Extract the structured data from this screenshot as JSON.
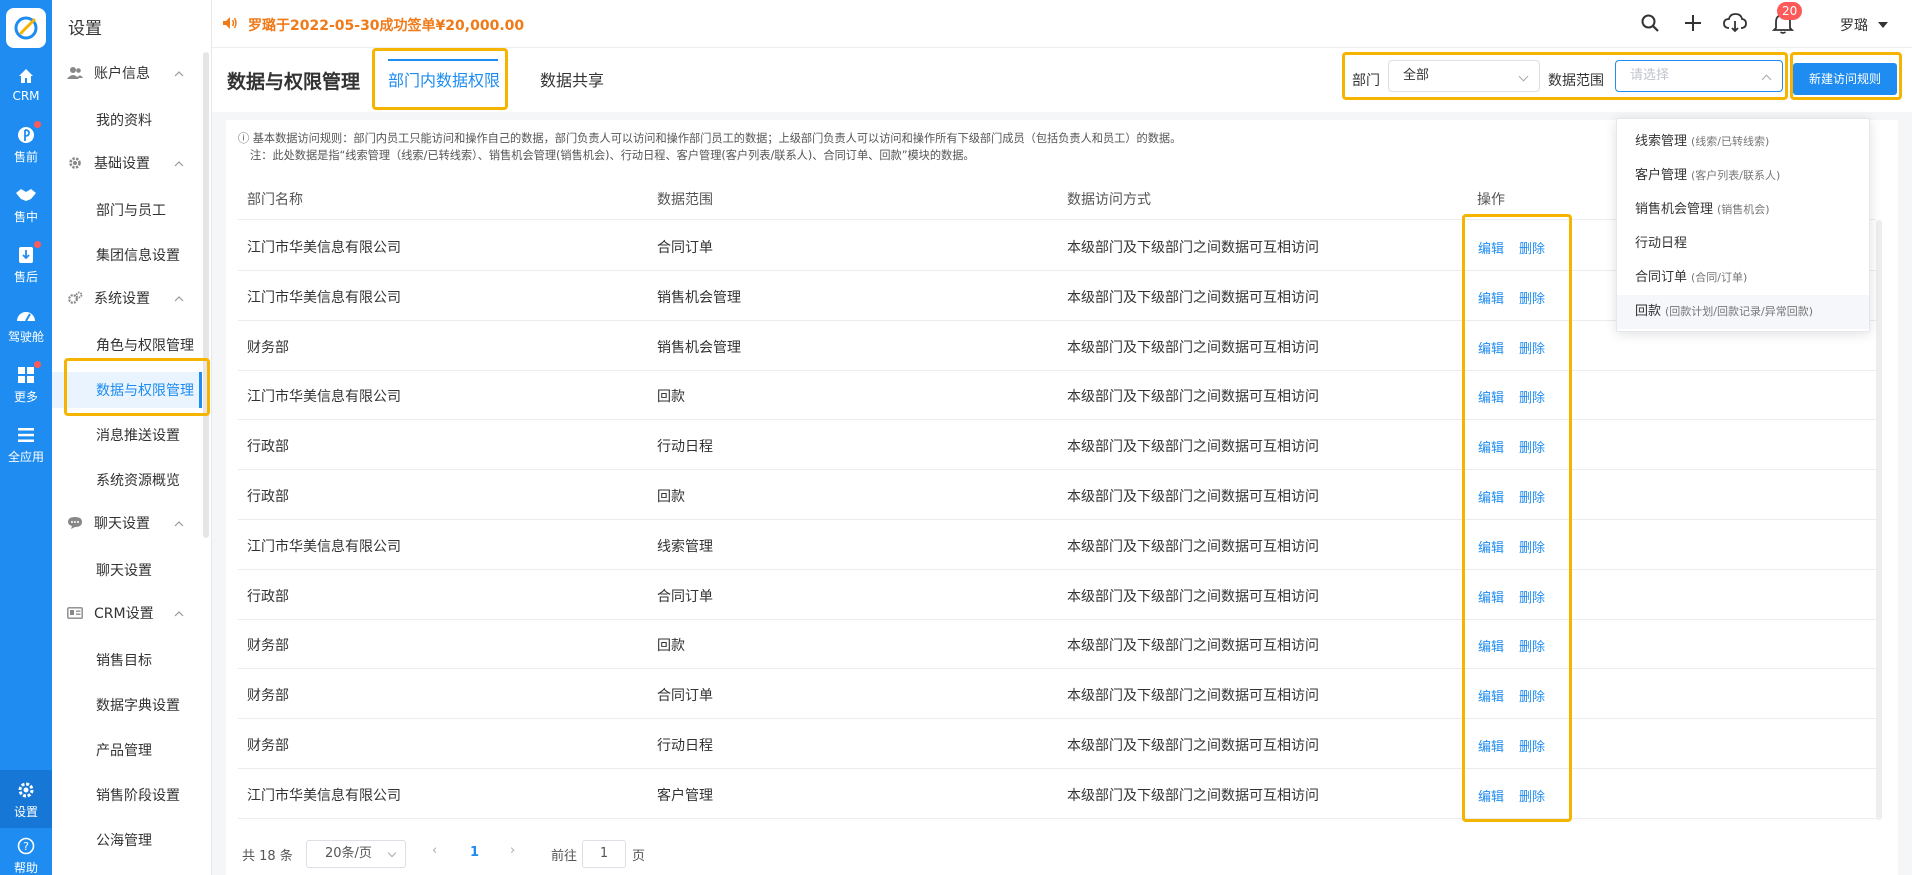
{
  "notice": "罗璐于2022-05-30成功签单¥20,000.00",
  "notification_count": "20",
  "user_name": "罗璐",
  "rail": [
    {
      "label": "CRM",
      "icon": "home-icon"
    },
    {
      "label": "售前",
      "icon": "pin-icon"
    },
    {
      "label": "售中",
      "icon": "handshake-icon"
    },
    {
      "label": "售后",
      "icon": "service-icon"
    },
    {
      "label": "驾驶舱",
      "icon": "dashboard-icon"
    },
    {
      "label": "更多",
      "icon": "grid-icon"
    },
    {
      "label": "全应用",
      "icon": "menu-icon"
    },
    {
      "label": "设置",
      "icon": "gear-icon"
    },
    {
      "label": "帮助",
      "icon": "help-icon"
    }
  ],
  "sidebar": {
    "title": "设置",
    "groups": [
      {
        "label": "账户信息",
        "items": [
          "我的资料"
        ]
      },
      {
        "label": "基础设置",
        "items": [
          "部门与员工",
          "集团信息设置"
        ]
      },
      {
        "label": "系统设置",
        "items": [
          "角色与权限管理",
          "数据与权限管理",
          "消息推送设置",
          "系统资源概览"
        ]
      },
      {
        "label": "聊天设置",
        "items": [
          "聊天设置"
        ]
      },
      {
        "label": "CRM设置",
        "items": [
          "销售目标",
          "数据字典设置",
          "产品管理",
          "销售阶段设置",
          "公海管理"
        ]
      }
    ]
  },
  "page": {
    "title": "数据与权限管理",
    "tabs": [
      "部门内数据权限",
      "数据共享"
    ],
    "filter_dept_label": "部门",
    "filter_dept_value": "全部",
    "filter_scope_label": "数据范围",
    "filter_scope_placeholder": "请选择",
    "new_rule_button": "新建访问规则"
  },
  "rules": {
    "line1": "ⓘ 基本数据访问规则：部门内员工只能访问和操作自己的数据，部门负责人可以访问和操作部门员工的数据；上级部门负责人可以访问和操作所有下级部门成员（包括负责人和员工）的数据。",
    "line2": "注：此处数据是指“线索管理（线索/已转线索）、销售机会管理(销售机会)、行动日程、客户管理(客户列表/联系人)、合同订单、回款”模块的数据。"
  },
  "table": {
    "headers": [
      "部门名称",
      "数据范围",
      "数据访问方式",
      "操作"
    ],
    "edit_label": "编辑",
    "delete_label": "删除",
    "rows": [
      [
        "江门市华美信息有限公司",
        "合同订单",
        "本级部门及下级部门之间数据可互相访问"
      ],
      [
        "江门市华美信息有限公司",
        "销售机会管理",
        "本级部门及下级部门之间数据可互相访问"
      ],
      [
        "财务部",
        "销售机会管理",
        "本级部门及下级部门之间数据可互相访问"
      ],
      [
        "江门市华美信息有限公司",
        "回款",
        "本级部门及下级部门之间数据可互相访问"
      ],
      [
        "行政部",
        "行动日程",
        "本级部门及下级部门之间数据可互相访问"
      ],
      [
        "行政部",
        "回款",
        "本级部门及下级部门之间数据可互相访问"
      ],
      [
        "江门市华美信息有限公司",
        "线索管理",
        "本级部门及下级部门之间数据可互相访问"
      ],
      [
        "行政部",
        "合同订单",
        "本级部门及下级部门之间数据可互相访问"
      ],
      [
        "财务部",
        "回款",
        "本级部门及下级部门之间数据可互相访问"
      ],
      [
        "财务部",
        "合同订单",
        "本级部门及下级部门之间数据可互相访问"
      ],
      [
        "财务部",
        "行动日程",
        "本级部门及下级部门之间数据可互相访问"
      ],
      [
        "江门市华美信息有限公司",
        "客户管理",
        "本级部门及下级部门之间数据可互相访问"
      ]
    ]
  },
  "dropdown": [
    {
      "label": "线索管理",
      "sub": "(线索/已转线索)"
    },
    {
      "label": "客户管理",
      "sub": "(客户列表/联系人)"
    },
    {
      "label": "销售机会管理",
      "sub": "(销售机会)"
    },
    {
      "label": "行动日程",
      "sub": ""
    },
    {
      "label": "合同订单",
      "sub": "(合同/订单)"
    },
    {
      "label": "回款",
      "sub": "(回款计划/回款记录/异常回款)"
    }
  ],
  "pagination": {
    "total": "共 18 条",
    "page_size": "20条/页",
    "current": "1",
    "goto_label": "前往",
    "goto_value": "1",
    "page_suffix": "页"
  },
  "colors": {
    "primary": "#1e8cf0",
    "highlight": "#f5b400",
    "notice": "#f07a18",
    "badge": "#ff5a5a"
  }
}
